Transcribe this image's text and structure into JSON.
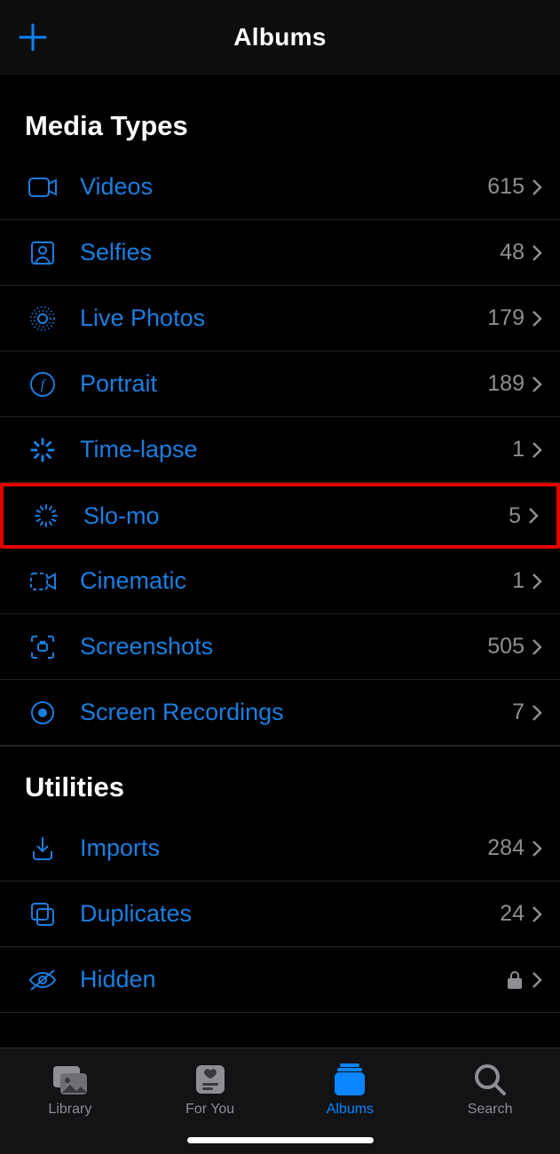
{
  "header": {
    "title": "Albums"
  },
  "sections": {
    "media_types": {
      "title": "Media Types",
      "items": [
        {
          "label": "Videos",
          "count": "615"
        },
        {
          "label": "Selfies",
          "count": "48"
        },
        {
          "label": "Live Photos",
          "count": "179"
        },
        {
          "label": "Portrait",
          "count": "189"
        },
        {
          "label": "Time-lapse",
          "count": "1"
        },
        {
          "label": "Slo-mo",
          "count": "5"
        },
        {
          "label": "Cinematic",
          "count": "1"
        },
        {
          "label": "Screenshots",
          "count": "505"
        },
        {
          "label": "Screen Recordings",
          "count": "7"
        }
      ]
    },
    "utilities": {
      "title": "Utilities",
      "items": [
        {
          "label": "Imports",
          "count": "284"
        },
        {
          "label": "Duplicates",
          "count": "24"
        },
        {
          "label": "Hidden",
          "locked": true
        }
      ]
    }
  },
  "tabbar": {
    "items": [
      {
        "label": "Library"
      },
      {
        "label": "For You"
      },
      {
        "label": "Albums"
      },
      {
        "label": "Search"
      }
    ]
  },
  "highlighted_row": "slo-mo"
}
